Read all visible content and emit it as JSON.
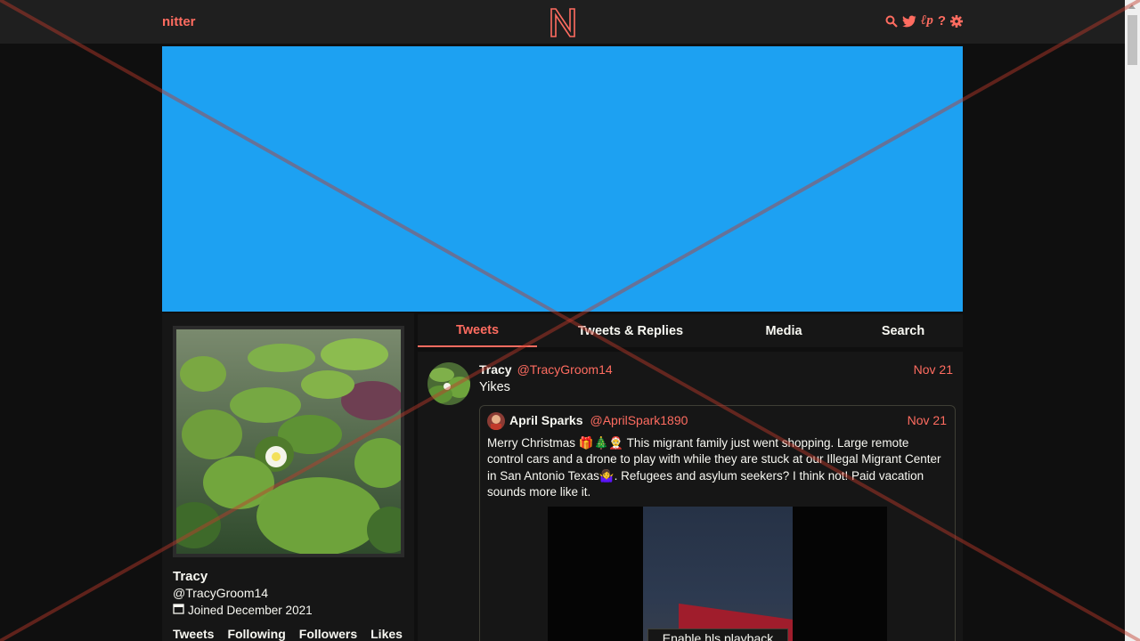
{
  "nav": {
    "brand": "nitter",
    "logo_letter": "N",
    "icons": [
      "search-icon",
      "bird-icon",
      "rss-icon",
      "help-icon",
      "settings-icon"
    ]
  },
  "colors": {
    "accent": "#ff6c60",
    "background": "#0f0f0f",
    "panel": "#161616",
    "banner": "#1da1f2"
  },
  "profile": {
    "name": "Tracy",
    "handle": "@TracyGroom14",
    "joined": "Joined December 2021",
    "stats": [
      "Tweets",
      "Following",
      "Followers",
      "Likes"
    ]
  },
  "tabs": [
    {
      "label": "Tweets",
      "active": true
    },
    {
      "label": "Tweets & Replies",
      "active": false
    },
    {
      "label": "Media",
      "active": false
    },
    {
      "label": "Search",
      "active": false
    }
  ],
  "tweet": {
    "fullname": "Tracy",
    "username": "@TracyGroom14",
    "date": "Nov 21",
    "text": "Yikes",
    "quote": {
      "fullname": "April Sparks",
      "username": "@AprilSpark1890",
      "date": "Nov 21",
      "text": "Merry Christmas 🎁🎄🤶 This migrant family just went shopping.  Large remote control cars and a drone to play with while they are stuck at our Illegal Migrant Center in San Antonio Texas🤷‍♀️. Refugees and asylum seekers? I think not!  Paid vacation sounds more like it.",
      "media_button": "Enable hls playback"
    }
  }
}
